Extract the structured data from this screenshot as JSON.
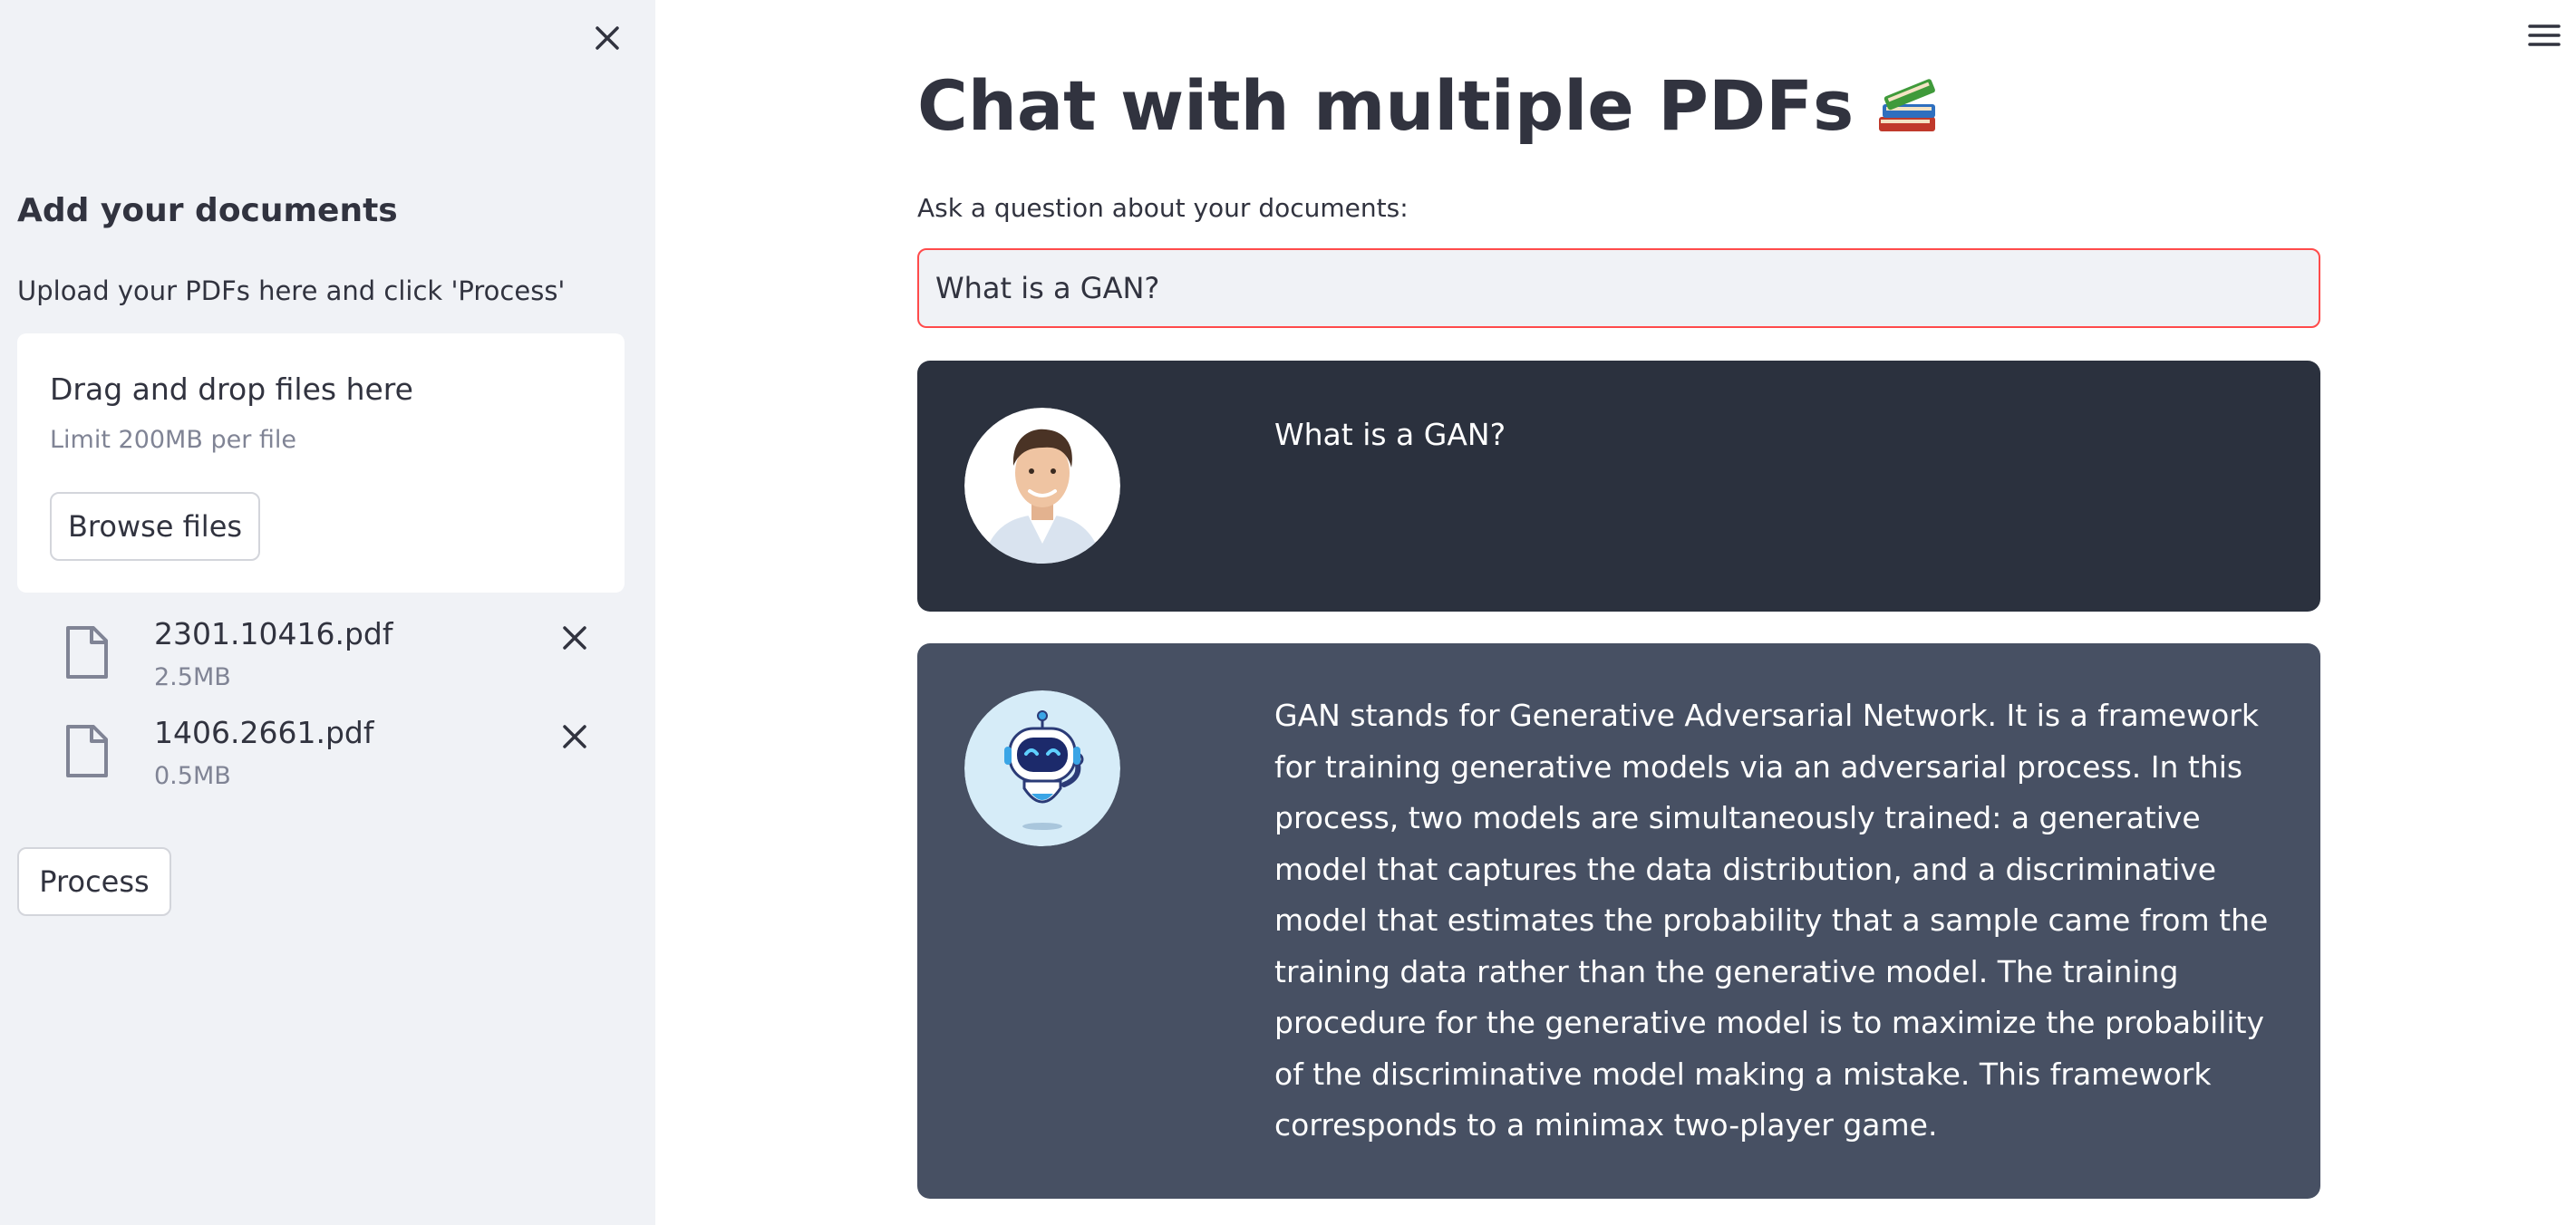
{
  "sidebar": {
    "heading": "Add your documents",
    "caption": "Upload your PDFs here and click 'Process'",
    "dropzone": {
      "title": "Drag and drop files here",
      "limit": "Limit 200MB per file",
      "browse_label": "Browse files"
    },
    "files": [
      {
        "name": "2301.10416.pdf",
        "size": "2.5MB"
      },
      {
        "name": "1406.2661.pdf",
        "size": "0.5MB"
      }
    ],
    "process_label": "Process"
  },
  "main": {
    "title": "Chat with multiple PDFs",
    "title_emoji": "books-icon",
    "question_label": "Ask a question about your documents:",
    "question_value": "What is a GAN?",
    "messages": [
      {
        "role": "user",
        "avatar": "user-avatar",
        "text": "What is a GAN?"
      },
      {
        "role": "bot",
        "avatar": "robot-avatar",
        "text": "GAN stands for Generative Adversarial Network. It is a framework for training generative models via an adversarial process. In this process, two models are simultaneously trained: a generative model that captures the data distribution, and a discriminative model that estimates the probability that a sample came from the training data rather than the generative model. The training procedure for the generative model is to maximize the probability of the discriminative model making a mistake. This framework corresponds to a minimax two-player game."
      }
    ]
  },
  "colors": {
    "sidebar_bg": "#f0f2f6",
    "user_msg_bg": "#2b313e",
    "bot_msg_bg": "#475063",
    "input_border": "#ff4b4b",
    "text": "#31333f",
    "muted_text": "#808495"
  }
}
